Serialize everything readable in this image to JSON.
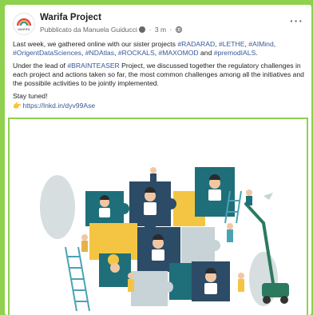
{
  "post": {
    "page_name": "Warifa Project",
    "meta_prefix": "Pubblicato da",
    "author": "Manuela Guiducci",
    "time": "3 m",
    "more_label": "···",
    "avatar_label": "WARIFA",
    "p1_a": "Last week, we gathered online with our sister projects ",
    "tag_radarad": "#RADARAD",
    "c1": ", ",
    "tag_lethe": "#LETHE",
    "c2": ", ",
    "tag_aimind": "#AIMind",
    "c3": ", ",
    "tag_origent": "#OrigentDataSciences",
    "c4": ", ",
    "tag_ndatlas": "#NDAtlas",
    "c5": ", ",
    "tag_rockals": "#ROCKALS",
    "c6": ", ",
    "tag_maxomod": "#MAXOMOD",
    "c7": " and ",
    "tag_premodials": "#premodIALS",
    "c8": ".",
    "p2_a": "Under the lead of ",
    "tag_brainteaser": "#BRAINTEASER",
    "p2_b": " Project, we discussed together the regulatory challenges in each project and actions taken so far, the most common challenges among all the initiatives and the possibile activities to be jointly implemented.",
    "p3": "Stay tuned!",
    "link": "https://lnkd.in/dyv99Ase"
  },
  "colors": {
    "background": "#8fd14f",
    "hashtag": "#385898",
    "puzzle_teal": "#1f6f7a",
    "puzzle_yellow": "#f4c542",
    "puzzle_light": "#c7d3d6",
    "puzzle_blue": "#2c4b66"
  },
  "icons": {
    "more": "ellipsis-icon",
    "audience": "globe-icon",
    "link_pointer": "pointing-hand-icon"
  }
}
